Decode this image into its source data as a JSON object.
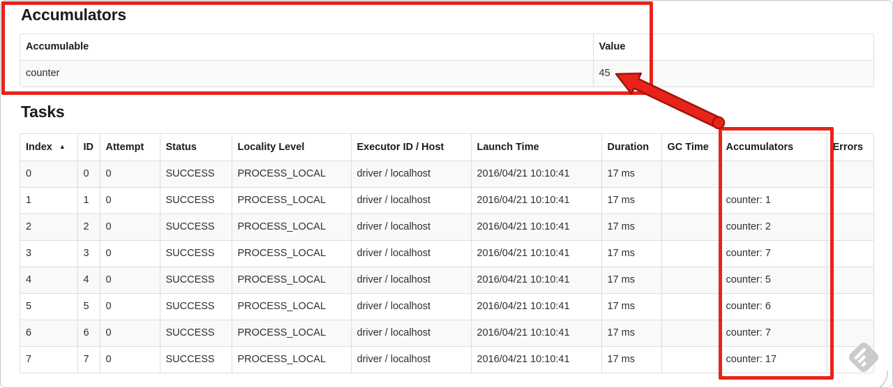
{
  "accumulators_section": {
    "title": "Accumulators",
    "table": {
      "headers": [
        "Accumulable",
        "Value"
      ],
      "rows": [
        {
          "accumulable": "counter",
          "value": "45"
        }
      ]
    }
  },
  "tasks_section": {
    "title": "Tasks",
    "table": {
      "sort_indicator": "▲",
      "headers": [
        "Index",
        "ID",
        "Attempt",
        "Status",
        "Locality Level",
        "Executor ID / Host",
        "Launch Time",
        "Duration",
        "GC Time",
        "Accumulators",
        "Errors"
      ],
      "rows": [
        {
          "index": "0",
          "id": "0",
          "attempt": "0",
          "status": "SUCCESS",
          "locality_level": "PROCESS_LOCAL",
          "executor_id_host": "driver / localhost",
          "launch_time": "2016/04/21 10:10:41",
          "duration": "17 ms",
          "gc_time": "",
          "accumulators": "",
          "errors": ""
        },
        {
          "index": "1",
          "id": "1",
          "attempt": "0",
          "status": "SUCCESS",
          "locality_level": "PROCESS_LOCAL",
          "executor_id_host": "driver / localhost",
          "launch_time": "2016/04/21 10:10:41",
          "duration": "17 ms",
          "gc_time": "",
          "accumulators": "counter: 1",
          "errors": ""
        },
        {
          "index": "2",
          "id": "2",
          "attempt": "0",
          "status": "SUCCESS",
          "locality_level": "PROCESS_LOCAL",
          "executor_id_host": "driver / localhost",
          "launch_time": "2016/04/21 10:10:41",
          "duration": "17 ms",
          "gc_time": "",
          "accumulators": "counter: 2",
          "errors": ""
        },
        {
          "index": "3",
          "id": "3",
          "attempt": "0",
          "status": "SUCCESS",
          "locality_level": "PROCESS_LOCAL",
          "executor_id_host": "driver / localhost",
          "launch_time": "2016/04/21 10:10:41",
          "duration": "17 ms",
          "gc_time": "",
          "accumulators": "counter: 7",
          "errors": ""
        },
        {
          "index": "4",
          "id": "4",
          "attempt": "0",
          "status": "SUCCESS",
          "locality_level": "PROCESS_LOCAL",
          "executor_id_host": "driver / localhost",
          "launch_time": "2016/04/21 10:10:41",
          "duration": "17 ms",
          "gc_time": "",
          "accumulators": "counter: 5",
          "errors": ""
        },
        {
          "index": "5",
          "id": "5",
          "attempt": "0",
          "status": "SUCCESS",
          "locality_level": "PROCESS_LOCAL",
          "executor_id_host": "driver / localhost",
          "launch_time": "2016/04/21 10:10:41",
          "duration": "17 ms",
          "gc_time": "",
          "accumulators": "counter: 6",
          "errors": ""
        },
        {
          "index": "6",
          "id": "6",
          "attempt": "0",
          "status": "SUCCESS",
          "locality_level": "PROCESS_LOCAL",
          "executor_id_host": "driver / localhost",
          "launch_time": "2016/04/21 10:10:41",
          "duration": "17 ms",
          "gc_time": "",
          "accumulators": "counter: 7",
          "errors": ""
        },
        {
          "index": "7",
          "id": "7",
          "attempt": "0",
          "status": "SUCCESS",
          "locality_level": "PROCESS_LOCAL",
          "executor_id_host": "driver / localhost",
          "launch_time": "2016/04/21 10:10:41",
          "duration": "17 ms",
          "gc_time": "",
          "accumulators": "counter: 17",
          "errors": ""
        }
      ]
    }
  },
  "annotations": {
    "highlight_color": "#e8231a"
  }
}
